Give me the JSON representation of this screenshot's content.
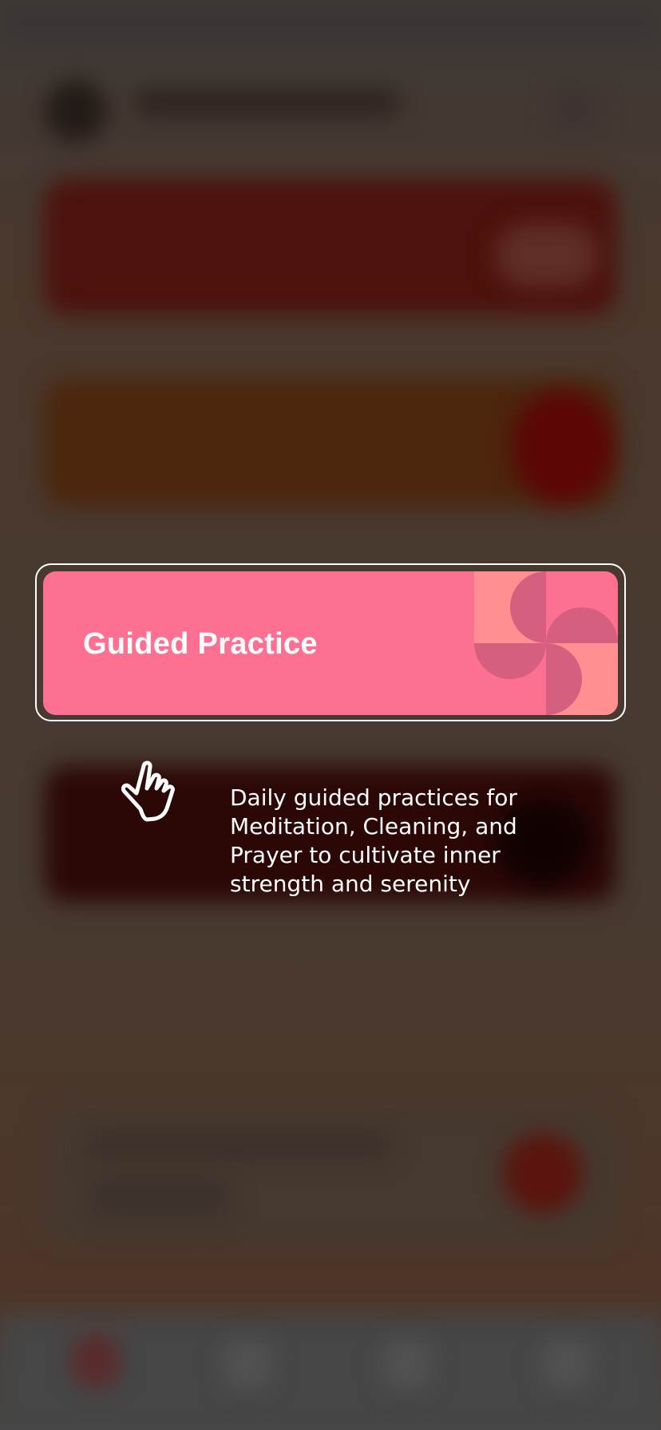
{
  "coach_mark": {
    "highlighted_card": {
      "title": "Guided Practice",
      "color": "#fd7092",
      "art_colors": [
        "#ff8f91",
        "#d65f80"
      ]
    },
    "description": "Daily guided practices for Meditation, Cleaning, and Prayer to cultivate inner strength and serenity",
    "icon": "tap-hand-icon"
  },
  "background": {
    "state": "blurred-dimmed",
    "tab_accent": "#8b1d1d"
  }
}
